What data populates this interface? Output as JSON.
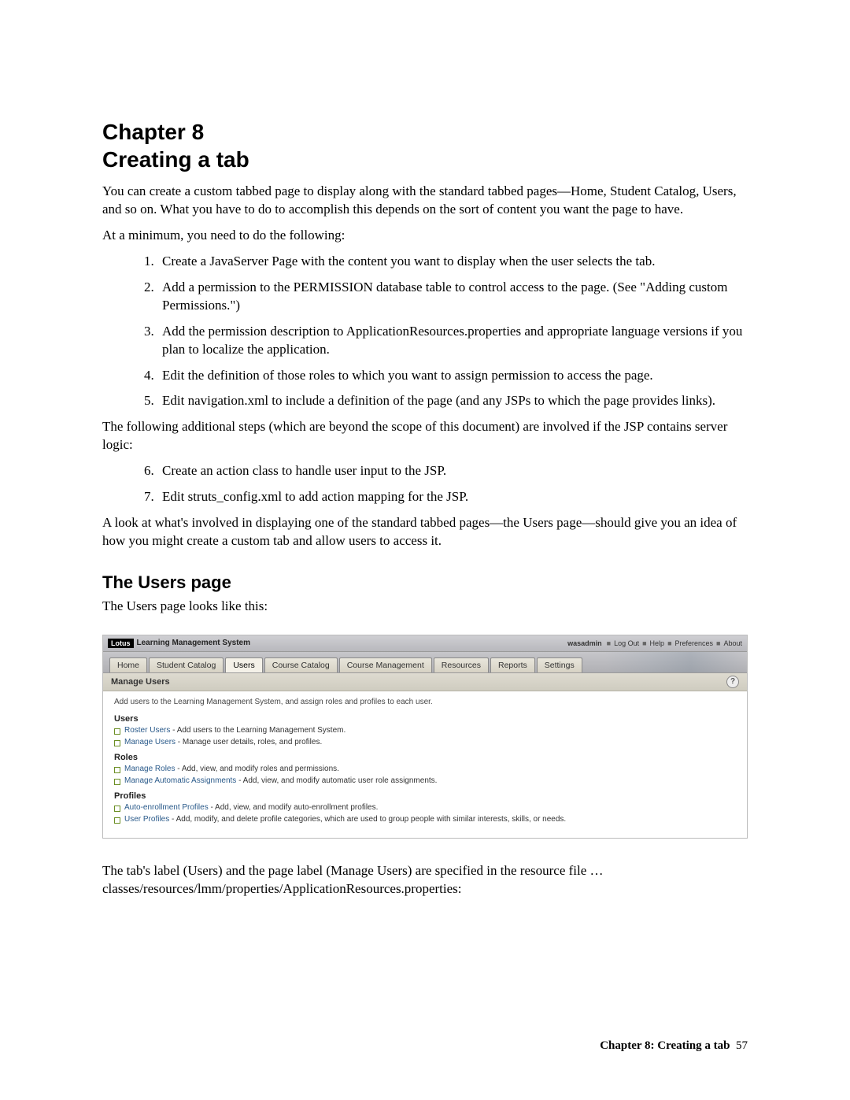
{
  "chapter": {
    "number_line": "Chapter 8",
    "title_line": "Creating a tab"
  },
  "intro": "You can create a custom tabbed page to display along with the standard tabbed pages—Home, Student Catalog, Users, and so on. What you have to do to accomplish this depends on the sort of content you want the page to have.",
  "minimum_lead": "At a minimum, you need to do the following:",
  "steps_a": [
    "Create a JavaServer Page with the content you want to display when the user selects the tab.",
    "Add a permission to the PERMISSION database table to control access to the page. (See \"Adding custom Permissions.\")",
    "Add the permission description to ApplicationResources.properties and appropriate language versions if you plan to localize the application.",
    "Edit the definition of those roles to which you want to assign permission to access the page.",
    "Edit navigation.xml to include a definition of the page (and any JSPs to which the page provides links)."
  ],
  "additional_lead": "The following additional steps (which are beyond the scope of this document) are involved if the JSP contains server logic:",
  "steps_b": [
    "Create an action class to handle user input to the JSP.",
    "Edit struts_config.xml to add action mapping for the JSP."
  ],
  "closing": "A look at what's involved in displaying one of the standard tabbed pages—the Users page—should give you an idea of how you might create a custom tab and allow users to access it.",
  "section2": {
    "title": "The Users page",
    "lead": "The Users page looks like this:"
  },
  "screenshot": {
    "brand_badge": "Lotus",
    "product": "Learning Management System",
    "top_right": {
      "user": "wasadmin",
      "links": [
        "Log Out",
        "Help",
        "Preferences",
        "About"
      ]
    },
    "tabs": [
      "Home",
      "Student Catalog",
      "Users",
      "Course Catalog",
      "Course Management",
      "Resources",
      "Reports",
      "Settings"
    ],
    "active_tab_index": 2,
    "panel_title": "Manage Users",
    "panel_lead": "Add users to the Learning Management System, and assign roles and profiles to each user.",
    "groups": [
      {
        "title": "Users",
        "items": [
          {
            "link": "Roster Users",
            "desc": " - Add users to the Learning Management System."
          },
          {
            "link": "Manage Users",
            "desc": " - Manage user details, roles, and profiles."
          }
        ]
      },
      {
        "title": "Roles",
        "items": [
          {
            "link": "Manage Roles",
            "desc": " - Add, view, and modify roles and permissions."
          },
          {
            "link": "Manage Automatic Assignments",
            "desc": " - Add, view, and modify automatic user role assignments."
          }
        ]
      },
      {
        "title": "Profiles",
        "items": [
          {
            "link": "Auto-enrollment Profiles",
            "desc": " - Add, view, and modify auto-enrollment profiles."
          },
          {
            "link": "User Profiles",
            "desc": " - Add, modify, and delete profile categories, which are used to group people with similar interests, skills, or needs."
          }
        ]
      }
    ]
  },
  "after_shot": "The tab's label (Users) and the page label (Manage Users) are specified in the resource file …classes/resources/lmm/properties/ApplicationResources.properties:",
  "footer": {
    "label": "Chapter 8: Creating a tab",
    "page": "57"
  }
}
